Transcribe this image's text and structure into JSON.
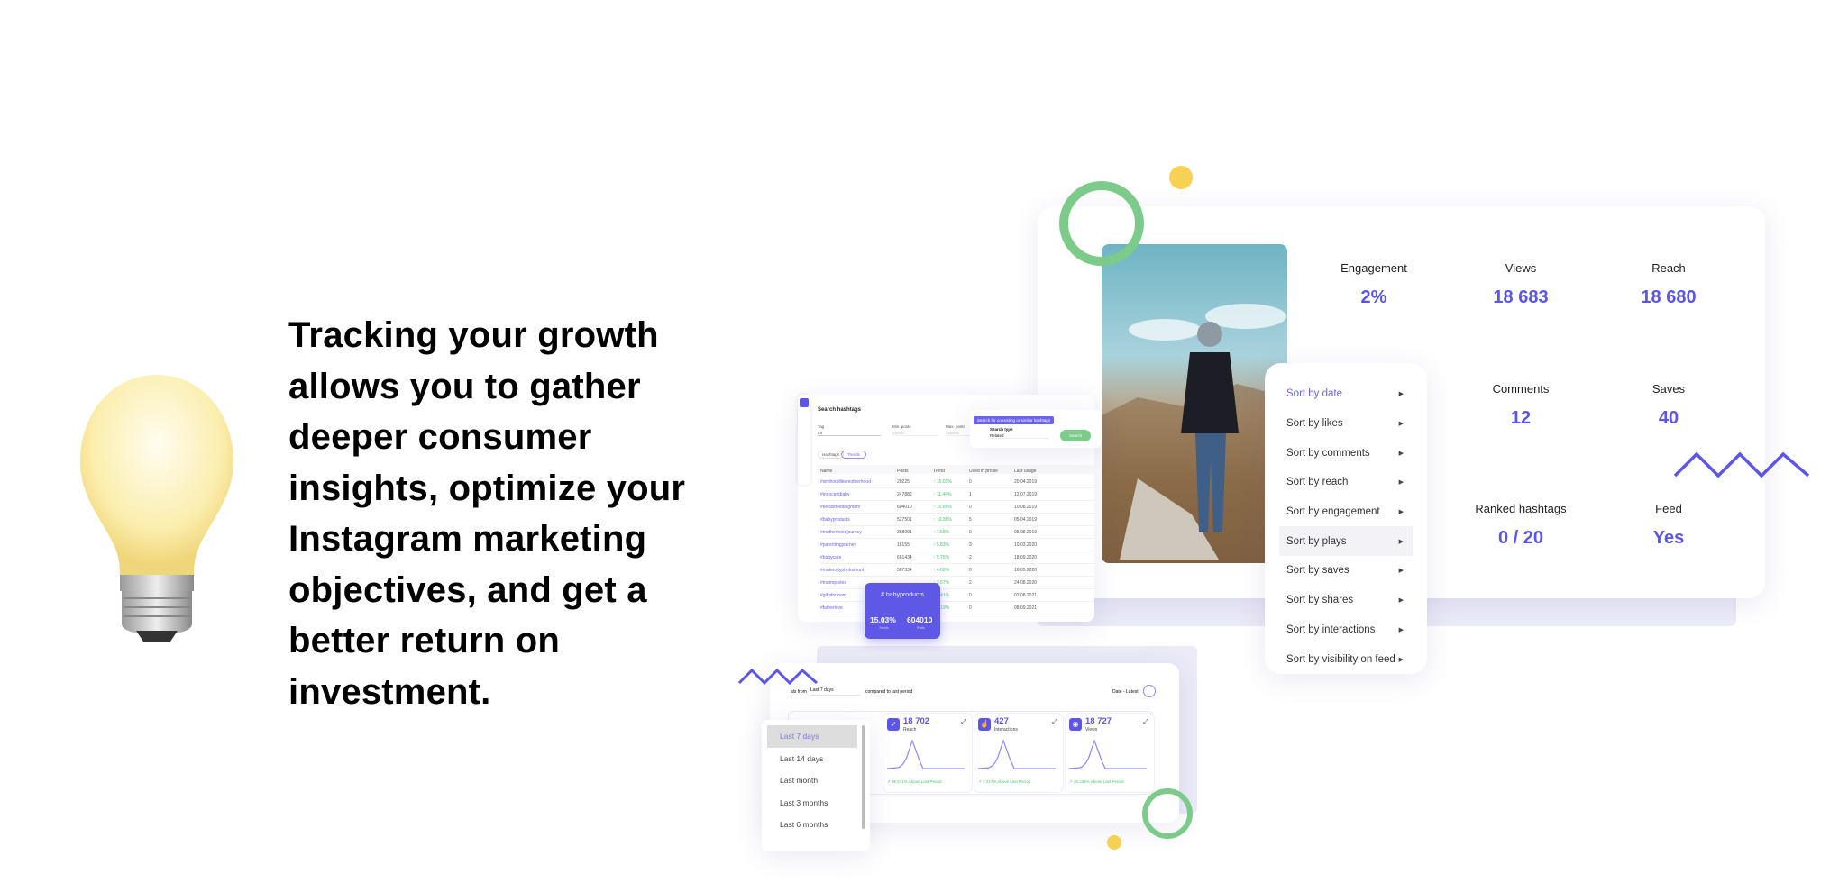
{
  "headline": {
    "lines": [
      "Tracking your growth",
      "allows you to gather",
      "deeper consumer",
      "insights, optimize your",
      "Instagram marketing",
      "objectives, and get a",
      "better return on",
      "investment."
    ]
  },
  "colors": {
    "accent": "#5c56e8",
    "green": "#7dcb8a",
    "yellow": "#f7d154",
    "trend_up": "#4cc46a"
  },
  "post_stats": [
    {
      "label": "Engagement",
      "value": "2%"
    },
    {
      "label": "Views",
      "value": "18 683"
    },
    {
      "label": "Reach",
      "value": "18 680"
    },
    {
      "label": "Comments",
      "value": "12"
    },
    {
      "label": "Saves",
      "value": "40"
    },
    {
      "label": "Ranked hashtags",
      "value": "0 / 20"
    },
    {
      "label": "Feed",
      "value": "Yes"
    }
  ],
  "sort_menu": {
    "items": [
      "Sort by date",
      "Sort by likes",
      "Sort by comments",
      "Sort by reach",
      "Sort by engagement",
      "Sort by plays",
      "Sort by saves",
      "Sort by shares",
      "Sort by interactions",
      "Sort by visibility on feed"
    ],
    "active": "Sort by date",
    "hovered": "Sort by plays"
  },
  "hashtag_search": {
    "title": "Search hashtags",
    "tooltip": "Search for coexisting or similar hashtags",
    "fields": {
      "tag_label": "Tag",
      "tag_value": "mr",
      "min_label": "Min. posts",
      "min_placeholder": "25000",
      "max_label": "Max. posts",
      "max_placeholder": "150000",
      "type_label": "Search type",
      "type_value": "Related"
    },
    "search_button": "Search",
    "tabs": [
      "Hashtags",
      "Trends"
    ],
    "columns": [
      "Name",
      "Posts",
      "Trend",
      "Used in profile",
      "Last usage"
    ],
    "rows": [
      [
        "#simhoodlikemotherhood",
        "20225",
        "↑ 15.03%",
        "0",
        "20.04.2019"
      ],
      [
        "#innocentbaby",
        "247882",
        "↑ 11.44%",
        "1",
        "12.07.2019"
      ],
      [
        "#breastfeedingmom",
        "604010",
        "↑ 10.85%",
        "0",
        "10.08.2019"
      ],
      [
        "#babyproducts",
        "527501",
        "↑ 10.38%",
        "5",
        "05.04.2019"
      ],
      [
        "#motherhoodjourney",
        "368091",
        "↑ 7.58%",
        "0",
        "05.08.2019"
      ],
      [
        "#parentingjourney",
        "18155",
        "↑ 5.83%",
        "3",
        "10.03.2020"
      ],
      [
        "#babycare",
        "661434",
        "↑ 5.75%",
        "2",
        "18.09.2020"
      ],
      [
        "#maternityphotoshoot",
        "567334",
        "↑ 4.09%",
        "0",
        "16.05.2020"
      ],
      [
        "#momquotes",
        "",
        "↑ 3.57%",
        "2",
        "24.08.2020"
      ],
      [
        "#giftsformom",
        "",
        "↑ 2.41%",
        "0",
        "02.08.2021"
      ],
      [
        "#fatherlove",
        "",
        "↑ 3.19%",
        "0",
        "08.09.2021"
      ]
    ],
    "popup": {
      "tag": "# babyproducts",
      "trend": "15.03%",
      "trend_label": "Trends",
      "posts": "604010",
      "posts_label": "Posts"
    }
  },
  "dashboard": {
    "filter_prefix": "als from",
    "period": "Last 7 days",
    "compare": "compared to last period",
    "sort": "Date - Latest",
    "cards": [
      {
        "icon": "rocket-icon",
        "value": "18 702",
        "label": "Reach",
        "change": "↗ 36.571%  Above Last Period"
      },
      {
        "icon": "hand-icon",
        "value": "427",
        "label": "Interactions",
        "change": "↗ 7.017%  Above Last Period"
      },
      {
        "icon": "eye-icon",
        "value": "18 727",
        "label": "Views",
        "change": "↗ 35.234%  Above Last Period"
      }
    ],
    "period_options": [
      "Last 7 days",
      "Last 14 days",
      "Last month",
      "Last 3 months",
      "Last 6 months"
    ]
  }
}
